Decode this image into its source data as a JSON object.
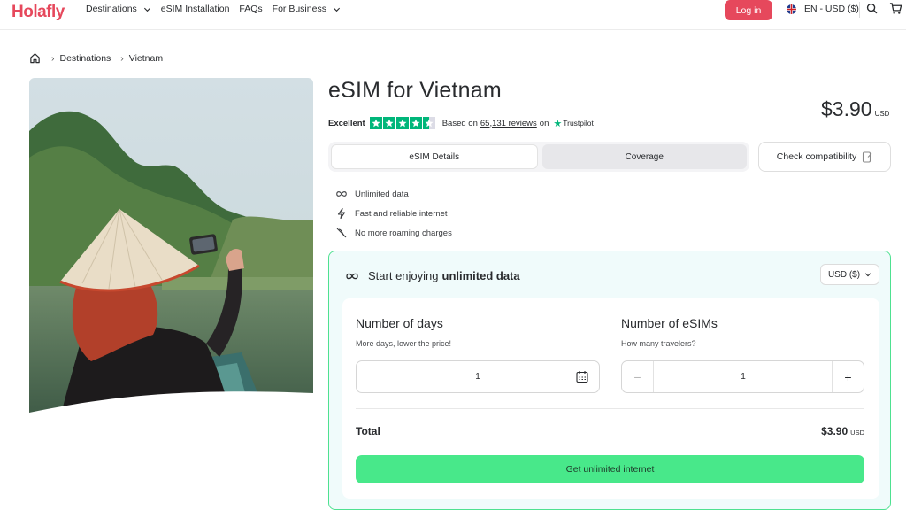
{
  "header": {
    "logo": "Holafly",
    "nav": [
      {
        "label": "Destinations",
        "dropdown": true
      },
      {
        "label": "eSIM Installation",
        "dropdown": false
      },
      {
        "label": "FAQs",
        "dropdown": false
      },
      {
        "label": "For Business",
        "dropdown": true
      }
    ],
    "login_label": "Log in",
    "locale_label": "EN - USD ($)",
    "icons": [
      "uk-flag-icon",
      "search-icon",
      "cart-icon"
    ],
    "brand_color": "#e6485c"
  },
  "breadcrumb": {
    "items": [
      "Destinations",
      "Vietnam"
    ]
  },
  "product": {
    "title": "eSIM for Vietnam",
    "rating_label": "Excellent",
    "stars": 4.5,
    "based_on": "Based on",
    "review_count": "65,131 reviews",
    "on": "on",
    "trustpilot": "Trustpilot",
    "price": "$3.90",
    "price_currency": "USD"
  },
  "tabs": [
    {
      "label": "eSIM Details",
      "active": true
    },
    {
      "label": "Coverage",
      "active": false
    }
  ],
  "check_compat_label": "Check compatibility",
  "features": [
    {
      "icon": "infinity-icon",
      "label": "Unlimited data"
    },
    {
      "icon": "lightning-icon",
      "label": "Fast and reliable internet"
    },
    {
      "icon": "no-roaming-icon",
      "label": "No more roaming charges"
    }
  ],
  "plan": {
    "heading_prefix": "Start enjoying",
    "heading_bold": "unlimited data",
    "currency_select": "USD ($)",
    "days_label": "Number of days",
    "days_sub": "More days, lower the price!",
    "days_value": "1",
    "esims_label": "Number of eSIMs",
    "esims_sub": "How many travelers?",
    "esims_value": "1",
    "minus": "−",
    "plus": "+",
    "total_label": "Total",
    "total_price": "$3.90",
    "total_currency": "USD",
    "cta_label": "Get unlimited internet",
    "accent": "#48e88a"
  }
}
